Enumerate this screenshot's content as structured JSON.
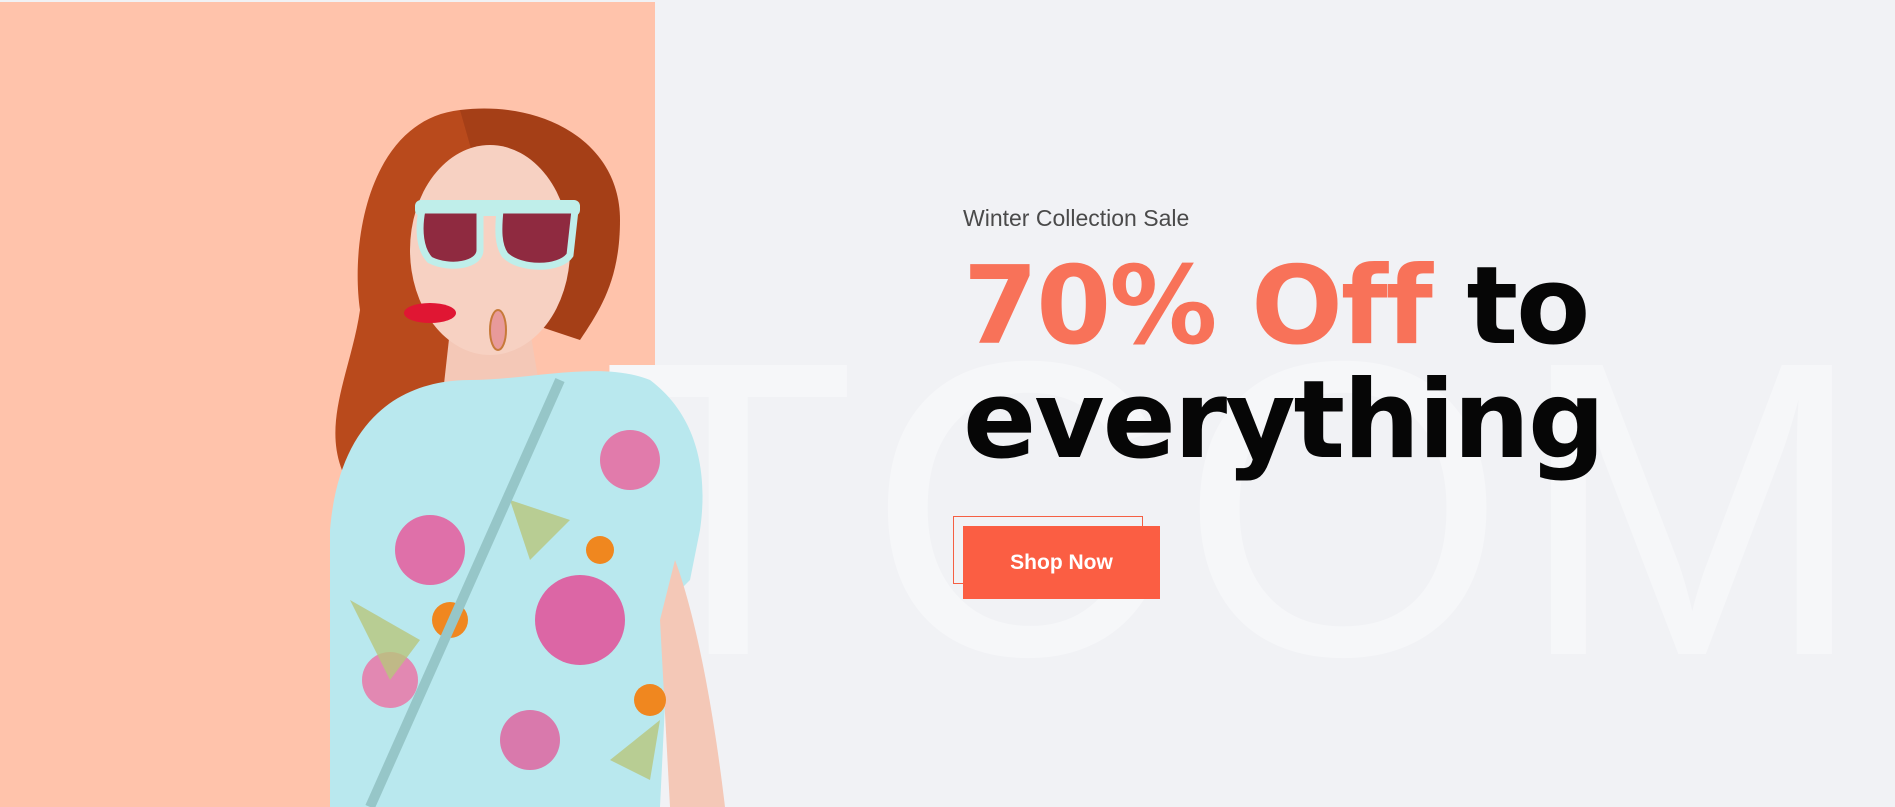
{
  "hero": {
    "watermark_text": "TCOM",
    "eyebrow": "Winter Collection Sale",
    "headline_accent": "70% Off",
    "headline_rest_line1": "to",
    "headline_line2": "everything",
    "cta_label": "Shop Now"
  },
  "colors": {
    "left_panel": "#ffc3ab",
    "background": "#f1f2f5",
    "accent": "#f87259",
    "cta": "#fb5e43",
    "headline": "#060606"
  },
  "icons": {
    "model_image": "fashion-model-photo"
  }
}
